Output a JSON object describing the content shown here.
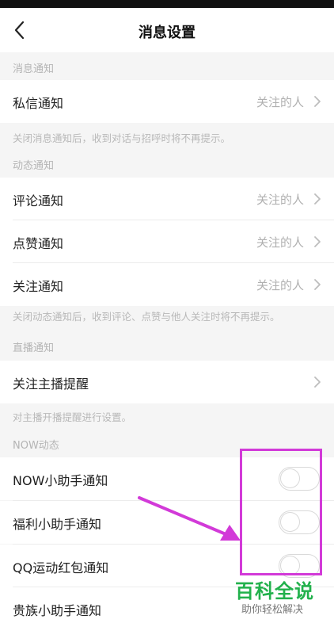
{
  "header": {
    "title": "消息设置",
    "back_icon": "chevron-left-icon"
  },
  "sections": {
    "messages": {
      "label": "消息通知",
      "items": [
        {
          "label": "私信通知",
          "value": "关注的人"
        }
      ],
      "hint": "关闭消息通知后，收到对话与招呼时将不再提示。"
    },
    "activity": {
      "label": "动态通知",
      "items": [
        {
          "label": "评论通知",
          "value": "关注的人"
        },
        {
          "label": "点赞通知",
          "value": "关注的人"
        },
        {
          "label": "关注通知",
          "value": "关注的人"
        }
      ],
      "hint": "关闭动态通知后，收到评论、点赞与他人关注时将不再提示。"
    },
    "live": {
      "label": "直播通知",
      "items": [
        {
          "label": "关注主播提醒"
        }
      ],
      "hint": "对主播开播提醒进行设置。"
    },
    "now": {
      "label": "NOW动态",
      "items": [
        {
          "label": "NOW小助手通知",
          "enabled": false
        },
        {
          "label": "福利小助手通知",
          "enabled": false
        },
        {
          "label": "QQ运动红包通知",
          "enabled": false
        },
        {
          "label": "贵族小助手通知",
          "enabled": false
        }
      ]
    }
  },
  "annotation": {
    "color": "#d23ad8"
  },
  "watermark": {
    "main": "百科全说",
    "sub": "助你轻松解决",
    "color": "#22b14c"
  }
}
